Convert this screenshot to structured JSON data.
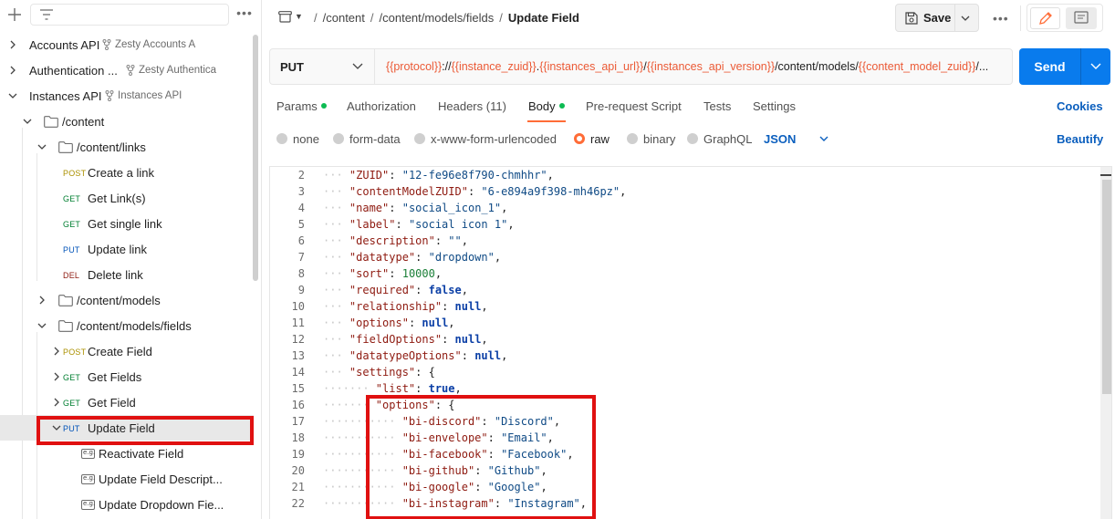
{
  "sidebar": {
    "search_placeholder": "",
    "tree": [
      {
        "label": "Accounts API",
        "sub": "Zesty Accounts A",
        "type": "collection"
      },
      {
        "label": "Authentication ...",
        "sub": "Zesty Authentica",
        "type": "collection"
      },
      {
        "label": "Instances API",
        "sub": "Instances API",
        "type": "collection"
      },
      {
        "label": "/content",
        "type": "folder"
      },
      {
        "label": "/content/links",
        "type": "folder"
      },
      {
        "label": "Create a link",
        "method": "POST",
        "type": "request"
      },
      {
        "label": "Get Link(s)",
        "method": "GET",
        "type": "request"
      },
      {
        "label": "Get single link",
        "method": "GET",
        "type": "request"
      },
      {
        "label": "Update link",
        "method": "PUT",
        "type": "request"
      },
      {
        "label": "Delete link",
        "method": "DEL",
        "type": "request"
      },
      {
        "label": "/content/models",
        "type": "folder"
      },
      {
        "label": "/content/models/fields",
        "type": "folder"
      },
      {
        "label": "Create Field",
        "method": "POST",
        "type": "request"
      },
      {
        "label": "Get Fields",
        "method": "GET",
        "type": "request"
      },
      {
        "label": "Get Field",
        "method": "GET",
        "type": "request"
      },
      {
        "label": "Update Field",
        "method": "PUT",
        "type": "request",
        "selected": true
      },
      {
        "label": "Reactivate Field",
        "type": "example"
      },
      {
        "label": "Update Field Descript...",
        "type": "example"
      },
      {
        "label": "Update Dropdown Fie...",
        "type": "example"
      }
    ]
  },
  "header": {
    "breadcrumbs": [
      "/content",
      "/content/models/fields",
      "Update Field"
    ],
    "save_label": "Save",
    "more_label": "•••"
  },
  "request": {
    "method": "PUT",
    "url_parts": [
      {
        "text": "{{protocol}}",
        "var": true
      },
      {
        "text": "://",
        "var": false
      },
      {
        "text": "{{instance_zuid}}",
        "var": true
      },
      {
        "text": ".",
        "var": false
      },
      {
        "text": "{{instances_api_url}}",
        "var": true
      },
      {
        "text": "/",
        "var": false
      },
      {
        "text": "{{instances_api_version}}",
        "var": true
      },
      {
        "text": "/content/models/",
        "var": false
      },
      {
        "text": "{{content_model_zuid}}",
        "var": true
      },
      {
        "text": "/...",
        "var": false
      }
    ],
    "send_label": "Send"
  },
  "tabs": [
    {
      "label": "Params",
      "dot": true
    },
    {
      "label": "Authorization",
      "dot": false
    },
    {
      "label": "Headers (11)",
      "dot": false
    },
    {
      "label": "Body",
      "dot": true,
      "active": true
    },
    {
      "label": "Pre-request Script",
      "dot": false
    },
    {
      "label": "Tests",
      "dot": false
    },
    {
      "label": "Settings",
      "dot": false
    }
  ],
  "cookies_label": "Cookies",
  "body_options": {
    "types": [
      "none",
      "form-data",
      "x-www-form-urlencoded",
      "raw",
      "binary",
      "GraphQL"
    ],
    "selected": "raw",
    "format": "JSON",
    "beautify_label": "Beautify"
  },
  "editor": {
    "lines": [
      {
        "n": "2",
        "indent": 1,
        "key": "ZUID",
        "value": "\"12-fe96e8f790-chmhhr\"",
        "vtype": "s",
        "trail": ","
      },
      {
        "n": "3",
        "indent": 1,
        "key": "contentModelZUID",
        "value": "\"6-e894a9f398-mh46pz\"",
        "vtype": "s",
        "trail": ","
      },
      {
        "n": "4",
        "indent": 1,
        "key": "name",
        "value": "\"social_icon_1\"",
        "vtype": "s",
        "trail": ","
      },
      {
        "n": "5",
        "indent": 1,
        "key": "label",
        "value": "\"social icon 1\"",
        "vtype": "s",
        "trail": ","
      },
      {
        "n": "6",
        "indent": 1,
        "key": "description",
        "value": "\"\"",
        "vtype": "s",
        "trail": ","
      },
      {
        "n": "7",
        "indent": 1,
        "key": "datatype",
        "value": "\"dropdown\"",
        "vtype": "s",
        "trail": ","
      },
      {
        "n": "8",
        "indent": 1,
        "key": "sort",
        "value": "10000",
        "vtype": "n",
        "trail": ","
      },
      {
        "n": "9",
        "indent": 1,
        "key": "required",
        "value": "false",
        "vtype": "b",
        "trail": ","
      },
      {
        "n": "10",
        "indent": 1,
        "key": "relationship",
        "value": "null",
        "vtype": "b",
        "trail": ","
      },
      {
        "n": "11",
        "indent": 1,
        "key": "options",
        "value": "null",
        "vtype": "b",
        "trail": ","
      },
      {
        "n": "12",
        "indent": 1,
        "key": "fieldOptions",
        "value": "null",
        "vtype": "b",
        "trail": ","
      },
      {
        "n": "13",
        "indent": 1,
        "key": "datatypeOptions",
        "value": "null",
        "vtype": "b",
        "trail": ","
      },
      {
        "n": "14",
        "indent": 1,
        "key": "settings",
        "value": "{",
        "vtype": "p",
        "trail": ""
      },
      {
        "n": "15",
        "indent": 2,
        "key": "list",
        "value": "true",
        "vtype": "b",
        "trail": ","
      },
      {
        "n": "16",
        "indent": 2,
        "key": "options",
        "value": "{",
        "vtype": "p",
        "trail": ""
      },
      {
        "n": "17",
        "indent": 3,
        "key": "bi-discord",
        "value": "\"Discord\"",
        "vtype": "s",
        "trail": ","
      },
      {
        "n": "18",
        "indent": 3,
        "key": "bi-envelope",
        "value": "\"Email\"",
        "vtype": "s",
        "trail": ","
      },
      {
        "n": "19",
        "indent": 3,
        "key": "bi-facebook",
        "value": "\"Facebook\"",
        "vtype": "s",
        "trail": ","
      },
      {
        "n": "20",
        "indent": 3,
        "key": "bi-github",
        "value": "\"Github\"",
        "vtype": "s",
        "trail": ","
      },
      {
        "n": "21",
        "indent": 3,
        "key": "bi-google",
        "value": "\"Google\"",
        "vtype": "s",
        "trail": ","
      },
      {
        "n": "22",
        "indent": 3,
        "key": "bi-instagram",
        "value": "\"Instagram\"",
        "vtype": "s",
        "trail": ","
      }
    ]
  },
  "colors": {
    "accent": "#ff6c37",
    "send": "#097bed",
    "link": "#0b5fbe",
    "highlight": "#e01010",
    "variable": "#eb5a36"
  }
}
